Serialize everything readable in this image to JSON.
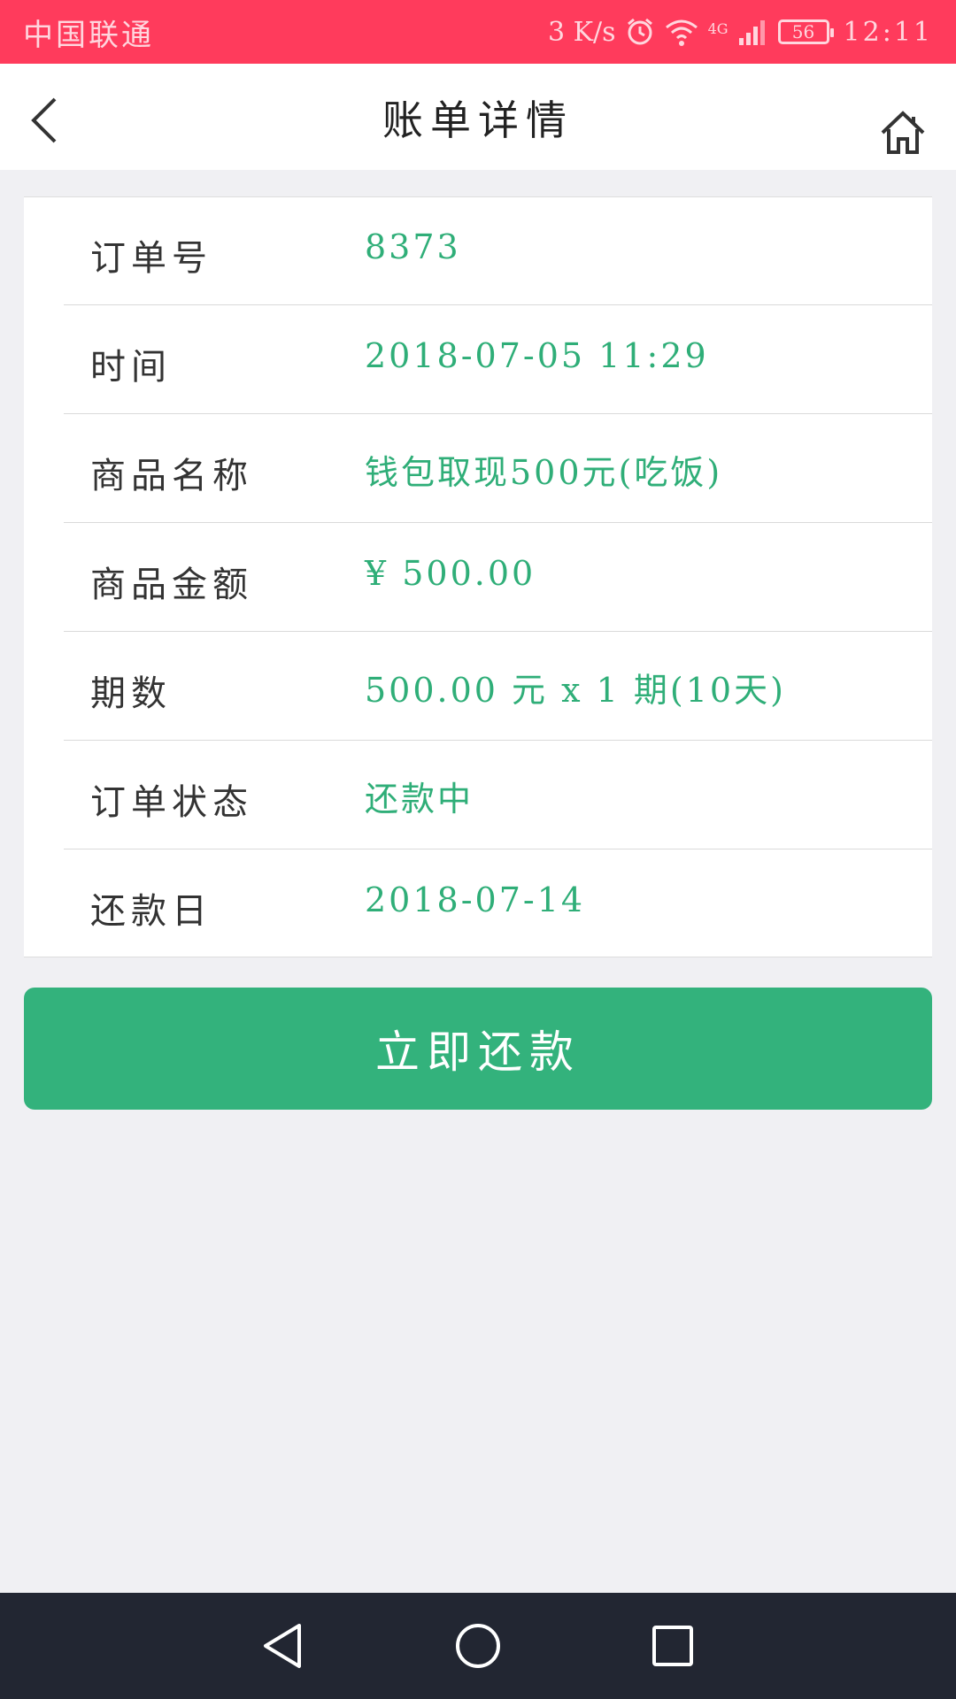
{
  "status_bar": {
    "carrier": "中国联通",
    "speed": "3 K/s",
    "network": "4G",
    "battery": "56",
    "time": "12:11"
  },
  "header": {
    "title": "账单详情"
  },
  "details": [
    {
      "label": "订单号",
      "value": "8373"
    },
    {
      "label": "时间",
      "value": "2018-07-05 11:29"
    },
    {
      "label": "商品名称",
      "value": "钱包取现500元(吃饭)"
    },
    {
      "label": "商品金额",
      "value": "¥ 500.00"
    },
    {
      "label": "期数",
      "value": "500.00 元 x 1 期(10天)"
    },
    {
      "label": "订单状态",
      "value": "还款中"
    },
    {
      "label": "还款日",
      "value": "2018-07-14"
    }
  ],
  "actions": {
    "repay_label": "立即还款"
  },
  "colors": {
    "status_bar": "#ff3b5c",
    "accent_green": "#33b27c",
    "value_text": "#2fae78",
    "nav_bar": "#222632"
  },
  "icons": {
    "back": "chevron-left-icon",
    "home": "home-icon",
    "nav_back": "triangle-back-icon",
    "nav_home": "circle-home-icon",
    "nav_recent": "square-recent-icon"
  }
}
